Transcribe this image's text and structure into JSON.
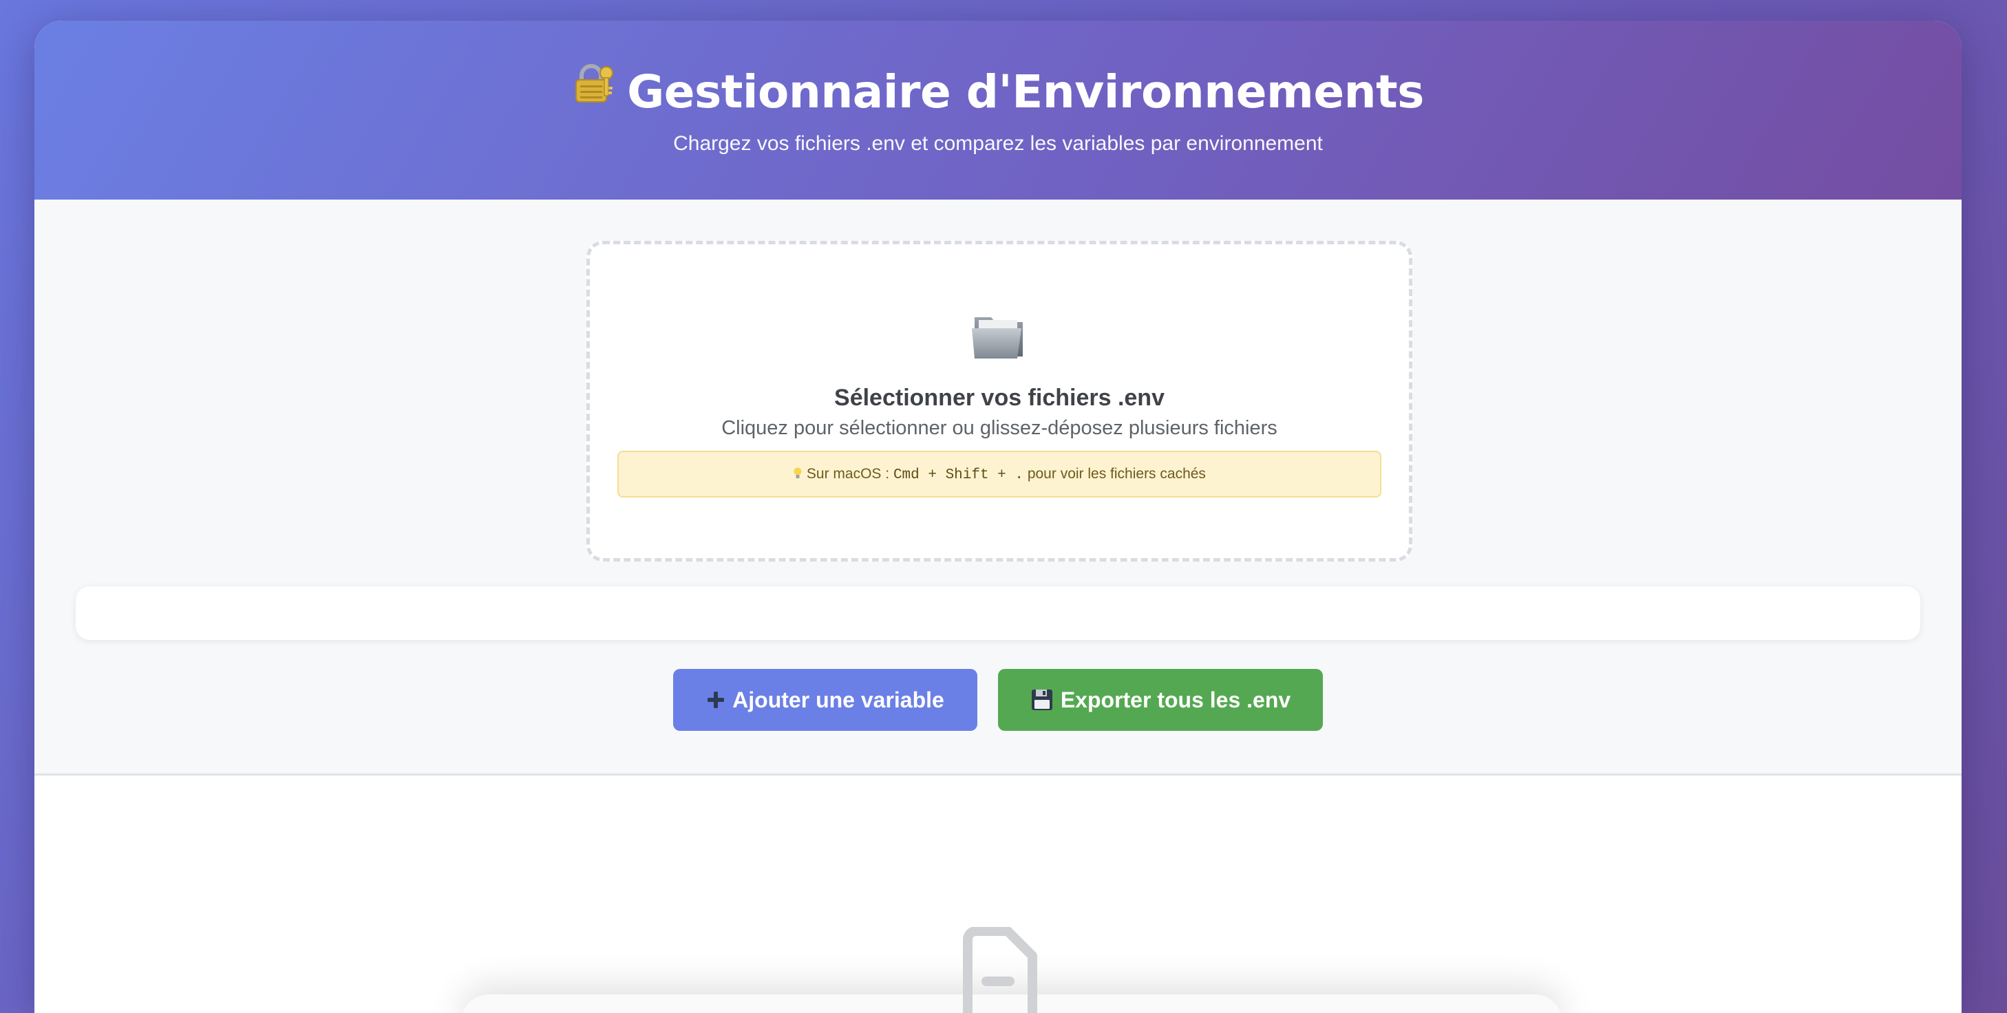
{
  "header": {
    "title": "Gestionnaire d'Environnements",
    "title_icon": "lock-with-key-icon",
    "subtitle": "Chargez vos fichiers .env et comparez les variables par environnement"
  },
  "upload": {
    "icon": "folder-icon",
    "title": "Sélectionner vos fichiers .env",
    "description": "Cliquez pour sélectionner ou glissez-déposez plusieurs fichiers",
    "tip": {
      "icon": "lightbulb-icon",
      "prefix": "Sur macOS :",
      "shortcut": "Cmd + Shift + .",
      "suffix": "pour voir les fichiers cachés"
    }
  },
  "actions": {
    "add_variable": "Ajouter une variable",
    "add_icon": "plus-icon",
    "export_all": "Exporter tous les .env",
    "export_icon": "floppy-disk-icon"
  },
  "empty_state": {
    "icon": "document-icon"
  },
  "colors": {
    "header_gradient_start": "#6b7fe3",
    "header_gradient_end": "#744ea2",
    "add_button": "#6b80e6",
    "export_button": "#55a852",
    "tip_background": "#fdf3d0"
  }
}
